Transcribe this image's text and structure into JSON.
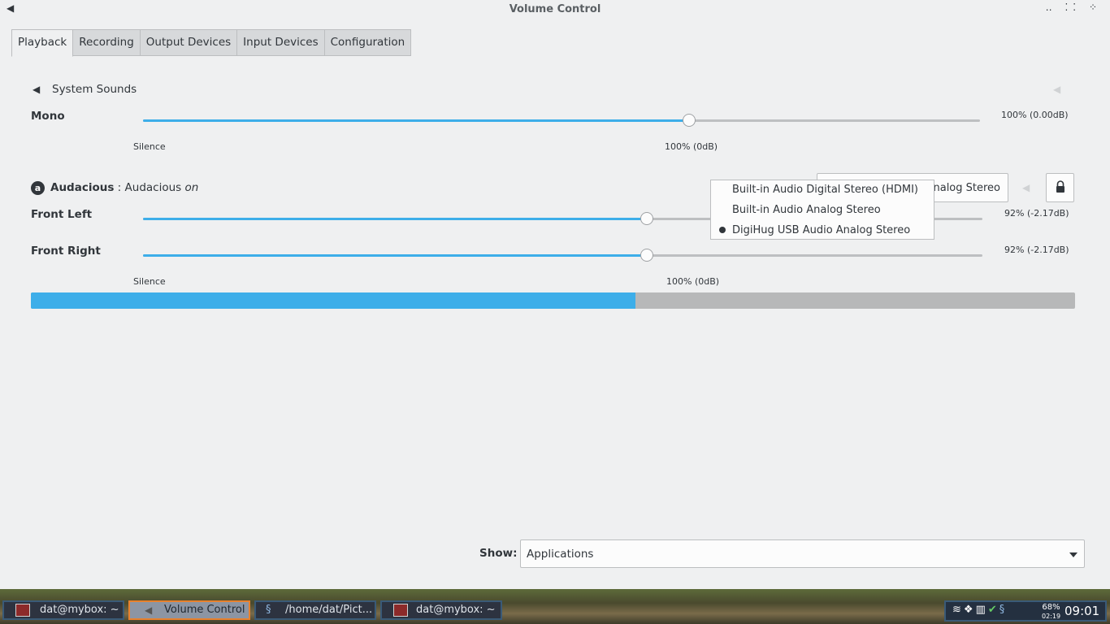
{
  "window": {
    "title": "Volume Control"
  },
  "tabs": [
    {
      "label": "Playback",
      "active": true
    },
    {
      "label": "Recording"
    },
    {
      "label": "Output Devices"
    },
    {
      "label": "Input Devices"
    },
    {
      "label": "Configuration"
    }
  ],
  "system_sounds": {
    "name": "System Sounds",
    "channel": "Mono",
    "level_percent": 100,
    "value_text": "100% (0.00dB)",
    "scale_min": "Silence",
    "scale_mid": "100% (0dB)"
  },
  "audacious": {
    "app_name": "Audacious",
    "separator": " : ",
    "stream_name": "Audacious",
    "state": "on",
    "device_button_text": "nalog Stereo",
    "channels": [
      {
        "name": "Front Left",
        "level_percent": 92,
        "value_text": "92% (-2.17dB)"
      },
      {
        "name": "Front Right",
        "level_percent": 92,
        "value_text": "92% (-2.17dB)"
      }
    ],
    "scale_min": "Silence",
    "scale_mid": "100% (0dB)",
    "peak_level_fraction": 0.579
  },
  "device_menu": {
    "items": [
      {
        "label": "Built-in Audio Digital Stereo (HDMI)",
        "selected": false
      },
      {
        "label": "Built-in Audio Analog Stereo",
        "selected": false
      },
      {
        "label": "DigiHug USB Audio Analog Stereo",
        "selected": true
      }
    ]
  },
  "show": {
    "label": "Show:",
    "value": "Applications"
  },
  "taskbar": {
    "tasks": [
      {
        "label": "dat@mybox: ~",
        "icon": "terminal-icon"
      },
      {
        "label": "Volume Control",
        "icon": "speaker-icon",
        "active": true
      },
      {
        "label": "/home/dat/Pict...",
        "icon": "image-viewer-icon"
      },
      {
        "label": "dat@mybox: ~",
        "icon": "terminal-icon"
      }
    ],
    "battery_percent": "68%",
    "battery_time": "02:19",
    "clock": "09:01"
  }
}
